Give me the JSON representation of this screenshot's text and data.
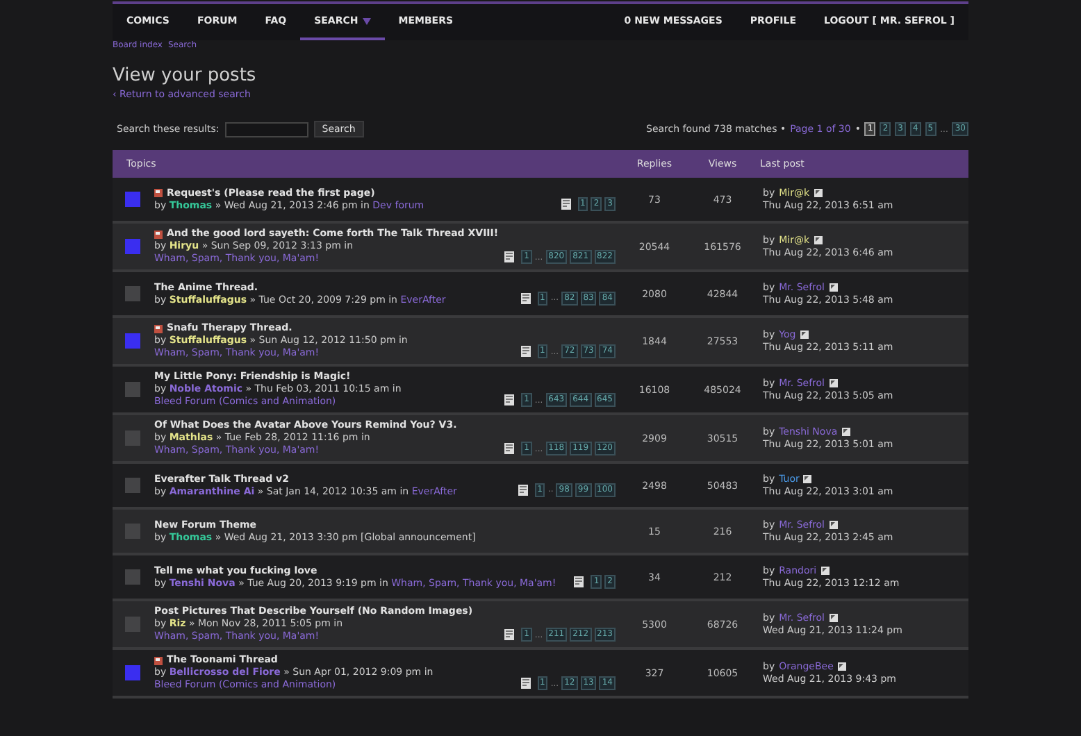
{
  "nav": {
    "left": [
      {
        "label": "COMICS",
        "selected": false
      },
      {
        "label": "FORUM",
        "selected": false
      },
      {
        "label": "FAQ",
        "selected": false
      },
      {
        "label": "SEARCH",
        "selected": true,
        "dropdown": true
      },
      {
        "label": "MEMBERS",
        "selected": false
      }
    ],
    "right": [
      {
        "label": "0 NEW MESSAGES"
      },
      {
        "label": "PROFILE"
      },
      {
        "label": "LOGOUT [ MR. SEFROL ]"
      }
    ]
  },
  "breadcrumb": [
    {
      "label": "Board index"
    },
    {
      "label": "Search"
    }
  ],
  "heading": "View your posts",
  "return_link": "‹ Return to advanced search",
  "search": {
    "label": "Search these results:",
    "button": "Search"
  },
  "results": {
    "summary": "Search found 738 matches •",
    "page_label": "Page 1 of 30",
    "separator": "•",
    "pages": [
      {
        "label": "1",
        "kind": "page",
        "selected": true
      },
      {
        "label": "2",
        "kind": "page",
        "selected": false
      },
      {
        "label": "3",
        "kind": "page",
        "selected": false
      },
      {
        "label": "4",
        "kind": "page",
        "selected": false
      },
      {
        "label": "5",
        "kind": "page",
        "selected": false
      },
      {
        "label": "...",
        "kind": "gap"
      },
      {
        "label": "30",
        "kind": "page",
        "selected": false
      }
    ]
  },
  "table": {
    "columns": [
      "Topics",
      "Replies",
      "Views",
      "Last post"
    ],
    "rows": [
      {
        "unread": true,
        "hot": true,
        "title": "Request's (Please read the first page)",
        "by": "by",
        "author": {
          "name": "Thomas",
          "color": "#35c99a"
        },
        "meta": "» Wed Aug 21, 2013 2:46 pm in",
        "forum": "Dev forum",
        "pages": [
          {
            "label": "1",
            "kind": "page"
          },
          {
            "label": "2",
            "kind": "page"
          },
          {
            "label": "3",
            "kind": "page"
          }
        ],
        "replies": "73",
        "views": "473",
        "last_by": "by",
        "last_author": {
          "name": "Mir@k",
          "color": "#e4e48a"
        },
        "last_date": "Thu Aug 22, 2013 6:51 am"
      },
      {
        "unread": true,
        "hot": true,
        "title": "And the good lord sayeth: Come forth The Talk Thread XVIII!",
        "by": "by",
        "author": {
          "name": "Hiryu",
          "color": "#e4e48a"
        },
        "meta": "» Sun Sep 09, 2012 3:13 pm in",
        "forum": "Wham, Spam, Thank you, Ma'am!",
        "pages": [
          {
            "label": "1",
            "kind": "page"
          },
          {
            "label": "...",
            "kind": "gap"
          },
          {
            "label": "820",
            "kind": "page"
          },
          {
            "label": "821",
            "kind": "page"
          },
          {
            "label": "822",
            "kind": "page"
          }
        ],
        "replies": "20544",
        "views": "161576",
        "last_by": "by",
        "last_author": {
          "name": "Mir@k",
          "color": "#e4e48a"
        },
        "last_date": "Thu Aug 22, 2013 6:46 am"
      },
      {
        "unread": false,
        "hot": false,
        "title": "The Anime Thread.",
        "by": "by",
        "author": {
          "name": "Stuffaluffagus",
          "color": "#e4e48a"
        },
        "meta": "» Tue Oct 20, 2009 7:29 pm in",
        "forum": "EverAfter",
        "pages": [
          {
            "label": "1",
            "kind": "page"
          },
          {
            "label": "...",
            "kind": "gap"
          },
          {
            "label": "82",
            "kind": "page"
          },
          {
            "label": "83",
            "kind": "page"
          },
          {
            "label": "84",
            "kind": "page"
          }
        ],
        "replies": "2080",
        "views": "42844",
        "last_by": "by",
        "last_author": {
          "name": "Mr. Sefrol",
          "color": "#8a6ad8"
        },
        "last_date": "Thu Aug 22, 2013 5:48 am"
      },
      {
        "unread": true,
        "hot": true,
        "title": "Snafu Therapy Thread.",
        "by": "by",
        "author": {
          "name": "Stuffaluffagus",
          "color": "#e4e48a"
        },
        "meta": "» Sun Aug 12, 2012 11:50 pm in",
        "forum": "Wham, Spam, Thank you, Ma'am!",
        "pages": [
          {
            "label": "1",
            "kind": "page"
          },
          {
            "label": "...",
            "kind": "gap"
          },
          {
            "label": "72",
            "kind": "page"
          },
          {
            "label": "73",
            "kind": "page"
          },
          {
            "label": "74",
            "kind": "page"
          }
        ],
        "replies": "1844",
        "views": "27553",
        "last_by": "by",
        "last_author": {
          "name": "Yog",
          "color": "#8a6ad8"
        },
        "last_date": "Thu Aug 22, 2013 5:11 am"
      },
      {
        "unread": false,
        "hot": false,
        "title": "My Little Pony: Friendship is Magic!",
        "by": "by",
        "author": {
          "name": "Noble Atomic",
          "color": "#8a6ad8"
        },
        "meta": "» Thu Feb 03, 2011 10:15 am in",
        "forum": "Bleed Forum (Comics and Animation)",
        "pages": [
          {
            "label": "1",
            "kind": "page"
          },
          {
            "label": "...",
            "kind": "gap"
          },
          {
            "label": "643",
            "kind": "page"
          },
          {
            "label": "644",
            "kind": "page"
          },
          {
            "label": "645",
            "kind": "page"
          }
        ],
        "replies": "16108",
        "views": "485024",
        "last_by": "by",
        "last_author": {
          "name": "Mr. Sefrol",
          "color": "#8a6ad8"
        },
        "last_date": "Thu Aug 22, 2013 5:05 am"
      },
      {
        "unread": false,
        "hot": false,
        "title": "Of What Does the Avatar Above Yours Remind You? V3.",
        "by": "by",
        "author": {
          "name": "Mathlas",
          "color": "#e4e48a"
        },
        "meta": "» Tue Feb 28, 2012 11:16 pm in",
        "forum": "Wham, Spam, Thank you, Ma'am!",
        "pages": [
          {
            "label": "1",
            "kind": "page"
          },
          {
            "label": "...",
            "kind": "gap"
          },
          {
            "label": "118",
            "kind": "page"
          },
          {
            "label": "119",
            "kind": "page"
          },
          {
            "label": "120",
            "kind": "page"
          }
        ],
        "replies": "2909",
        "views": "30515",
        "last_by": "by",
        "last_author": {
          "name": "Tenshi Nova",
          "color": "#8a6ad8"
        },
        "last_date": "Thu Aug 22, 2013 5:01 am"
      },
      {
        "unread": false,
        "hot": false,
        "title": "Everafter Talk Thread v2",
        "by": "by",
        "author": {
          "name": "Amaranthine Ai",
          "color": "#8a6ad8"
        },
        "meta": "» Sat Jan 14, 2012 10:35 am in",
        "forum": "EverAfter",
        "pages": [
          {
            "label": "1",
            "kind": "page"
          },
          {
            "label": "..",
            "kind": "gap"
          },
          {
            "label": "98",
            "kind": "page"
          },
          {
            "label": "99",
            "kind": "page"
          },
          {
            "label": "100",
            "kind": "page"
          }
        ],
        "replies": "2498",
        "views": "50483",
        "last_by": "by",
        "last_author": {
          "name": "Tuor",
          "color": "#4a9ae8"
        },
        "last_date": "Thu Aug 22, 2013 3:01 am"
      },
      {
        "unread": false,
        "hot": false,
        "title": "New Forum Theme",
        "by": "by",
        "author": {
          "name": "Thomas",
          "color": "#35c99a"
        },
        "meta": "» Wed Aug 21, 2013 3:30 pm [Global announcement]",
        "replies": "15",
        "views": "216",
        "last_by": "by",
        "last_author": {
          "name": "Mr. Sefrol",
          "color": "#8a6ad8"
        },
        "last_date": "Thu Aug 22, 2013 2:45 am"
      },
      {
        "unread": false,
        "hot": false,
        "title": "Tell me what you fucking love",
        "by": "by",
        "author": {
          "name": "Tenshi Nova",
          "color": "#8a6ad8"
        },
        "meta": "» Tue Aug 20, 2013 9:19 pm in",
        "forum": "Wham, Spam, Thank you, Ma'am!",
        "pages": [
          {
            "label": "1",
            "kind": "page"
          },
          {
            "label": "2",
            "kind": "page"
          }
        ],
        "replies": "34",
        "views": "212",
        "last_by": "by",
        "last_author": {
          "name": "Randori",
          "color": "#8a6ad8"
        },
        "last_date": "Thu Aug 22, 2013 12:12 am"
      },
      {
        "unread": false,
        "hot": false,
        "title": "Post Pictures That Describe Yourself (No Random Images)",
        "by": "by",
        "author": {
          "name": "Riz",
          "color": "#e4e48a"
        },
        "meta": "» Mon Nov 28, 2011 5:05 pm in",
        "forum": "Wham, Spam, Thank you, Ma'am!",
        "pages": [
          {
            "label": "1",
            "kind": "page"
          },
          {
            "label": "...",
            "kind": "gap"
          },
          {
            "label": "211",
            "kind": "page"
          },
          {
            "label": "212",
            "kind": "page"
          },
          {
            "label": "213",
            "kind": "page"
          }
        ],
        "replies": "5300",
        "views": "68726",
        "last_by": "by",
        "last_author": {
          "name": "Mr. Sefrol",
          "color": "#8a6ad8"
        },
        "last_date": "Wed Aug 21, 2013 11:24 pm"
      },
      {
        "unread": true,
        "hot": true,
        "title": "The Toonami Thread",
        "by": "by",
        "author": {
          "name": "Bellicrosso del Fiore",
          "color": "#8a6ad8"
        },
        "meta": "» Sun Apr 01, 2012 9:09 pm in",
        "forum": "Bleed Forum (Comics and Animation)",
        "pages": [
          {
            "label": "1",
            "kind": "page"
          },
          {
            "label": "...",
            "kind": "gap"
          },
          {
            "label": "12",
            "kind": "page"
          },
          {
            "label": "13",
            "kind": "page"
          },
          {
            "label": "14",
            "kind": "page"
          }
        ],
        "replies": "327",
        "views": "10605",
        "last_by": "by",
        "last_author": {
          "name": "OrangeBee",
          "color": "#8a6ad8"
        },
        "last_date": "Wed Aug 21, 2013 9:43 pm"
      }
    ]
  }
}
